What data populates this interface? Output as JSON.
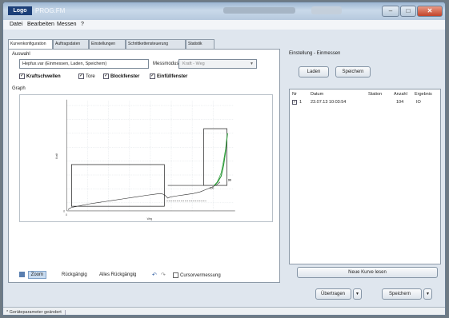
{
  "window": {
    "logo_text": "Logo",
    "title": "PROG.FM"
  },
  "menu": [
    "Datei",
    "Bearbeiten",
    "Messen",
    "?"
  ],
  "tabs": [
    "Kurvenkonfiguration",
    "Auftragsdaten",
    "Einstellungen",
    "Schrittkettensteuerung",
    "Statistik"
  ],
  "selection": {
    "label": "Auswahl",
    "combo_value": "Hepfux.var (Einmessen, Laden, Speichern)",
    "mode_label": "Messmodus",
    "mode_value": "Kraft - Weg"
  },
  "checkboxes": [
    {
      "label": "Kraftschwellen",
      "checked": true
    },
    {
      "label": "Tore",
      "checked": true
    },
    {
      "label": "Blockfenster",
      "checked": true
    },
    {
      "label": "Einfüllfenster",
      "checked": true
    }
  ],
  "graph": {
    "label": "Graph",
    "y_ticks": [
      "",
      "",
      "",
      "",
      "",
      "",
      "",
      "",
      "0"
    ],
    "y_axis_label": "Kraft",
    "x_ticks": [
      "0",
      "",
      "",
      "",
      "",
      "",
      "",
      "",
      ""
    ],
    "x_axis_label": "Weg",
    "annotations": {
      "value_a": "100",
      "value_b": "90"
    }
  },
  "toolbar": {
    "zoom_label": "Zoom",
    "undo_label": "Rückgängig",
    "undo_all_label": "Alles Rückgängig",
    "cursor_label": "Cursorvermessung"
  },
  "saving": {
    "label": "Einstellung - Einmessen",
    "load_button": "Laden",
    "save_button": "Speichern"
  },
  "curve_list": {
    "headers": [
      "Nr",
      "Datum",
      "Station",
      "Anzahl",
      "Ergebnis"
    ],
    "rows": [
      {
        "nr": "1",
        "checked": true,
        "date": "23.07.13 10:03:54",
        "station": "",
        "count": "104",
        "result": "IO"
      }
    ]
  },
  "new_curve_button": "Neue Kurve lesen",
  "bottom_buttons": {
    "transfer": "Übertragen",
    "store": "Speichern"
  },
  "status": {
    "text": "* Geräteparameter geändert"
  },
  "colors": {
    "curve_black": "#2a2a2a",
    "curve_green": "#2e9b3a",
    "window_accent": "#1c3f78"
  }
}
